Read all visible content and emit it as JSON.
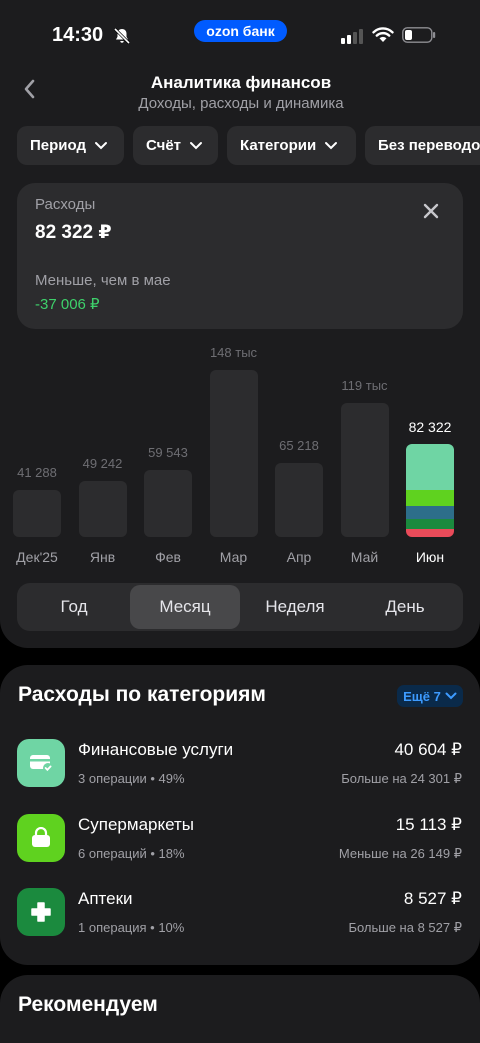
{
  "status": {
    "time": "14:30",
    "brand": "ozon банк"
  },
  "header": {
    "title": "Аналитика финансов",
    "subtitle": "Доходы, расходы и динамика"
  },
  "filters": [
    "Период",
    "Счёт",
    "Категории",
    "Без переводов"
  ],
  "summary": {
    "label": "Расходы",
    "value": "82 322 ₽",
    "compare_label": "Меньше, чем в мае",
    "compare_value": "-37 006 ₽"
  },
  "chart_data": {
    "type": "bar",
    "categories": [
      "Дек'25",
      "Янв",
      "Фев",
      "Мар",
      "Апр",
      "Май",
      "Июн"
    ],
    "values": [
      41288,
      49242,
      59543,
      148000,
      65218,
      119000,
      82322
    ],
    "value_labels": [
      "41 288",
      "49 242",
      "59 543",
      "148 тыс",
      "65 218",
      "119 тыс",
      "82 322"
    ],
    "active_index": 6,
    "active_segments": [
      {
        "category": "Финансовые услуги",
        "share": 0.49,
        "color": "#6fd5a4"
      },
      {
        "category": "Супермаркеты",
        "share": 0.18,
        "color": "#5fd21f"
      },
      {
        "category": "Аптеки",
        "share": 0.1,
        "color": "#1b8a3e"
      },
      {
        "category": "other-teal",
        "share": 0.14,
        "color": "#2d6e8a"
      },
      {
        "category": "other-red",
        "share": 0.09,
        "color": "#ea4b5a"
      }
    ]
  },
  "periods": {
    "items": [
      "Год",
      "Месяц",
      "Неделя",
      "День"
    ],
    "active": "Месяц"
  },
  "categories": {
    "title": "Расходы по категориям",
    "more": "Ещё 7",
    "items": [
      {
        "name": "Финансовые услуги",
        "meta": "3 операции • 49%",
        "amount": "40 604 ₽",
        "compare": "Больше на 24 301 ₽",
        "color": "#6fd5a4",
        "icon": "card-check-icon"
      },
      {
        "name": "Супермаркеты",
        "meta": "6 операций • 18%",
        "amount": "15 113 ₽",
        "compare": "Меньше на 26 149 ₽",
        "color": "#5fd21f",
        "icon": "shopping-bag-icon"
      },
      {
        "name": "Аптеки",
        "meta": "1 операция • 10%",
        "amount": "8 527 ₽",
        "compare": "Больше на 8 527 ₽",
        "color": "#1b8a3e",
        "icon": "medical-cross-icon"
      }
    ]
  },
  "recommend": {
    "title": "Рекомендуем"
  }
}
